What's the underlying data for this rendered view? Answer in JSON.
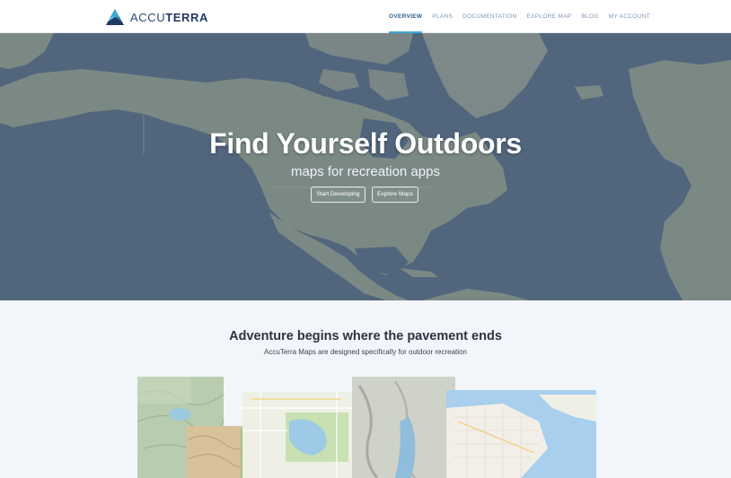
{
  "brand": {
    "name_light": "ACCU",
    "name_bold": "TERRA",
    "logo_icon": "mountain-triangle-icon",
    "colors": {
      "accent": "#39a9d8",
      "navy": "#1f3a60"
    }
  },
  "nav": {
    "items": [
      {
        "label": "OVERVIEW",
        "active": true
      },
      {
        "label": "PLANS"
      },
      {
        "label": "DOCUMENTATION"
      },
      {
        "label": "EXPLORE MAP"
      },
      {
        "label": "BLOG"
      },
      {
        "label": "MY ACCOUNT"
      }
    ]
  },
  "hero": {
    "title": "Find Yourself Outdoors",
    "subtitle": "maps for recreation apps",
    "buttons": [
      {
        "label": "Start Developing"
      },
      {
        "label": "Explore Maps"
      }
    ]
  },
  "section": {
    "title": "Adventure begins where the pavement ends",
    "subtitle": "AccuTerra Maps are designed specifically for outdoor recreation"
  }
}
